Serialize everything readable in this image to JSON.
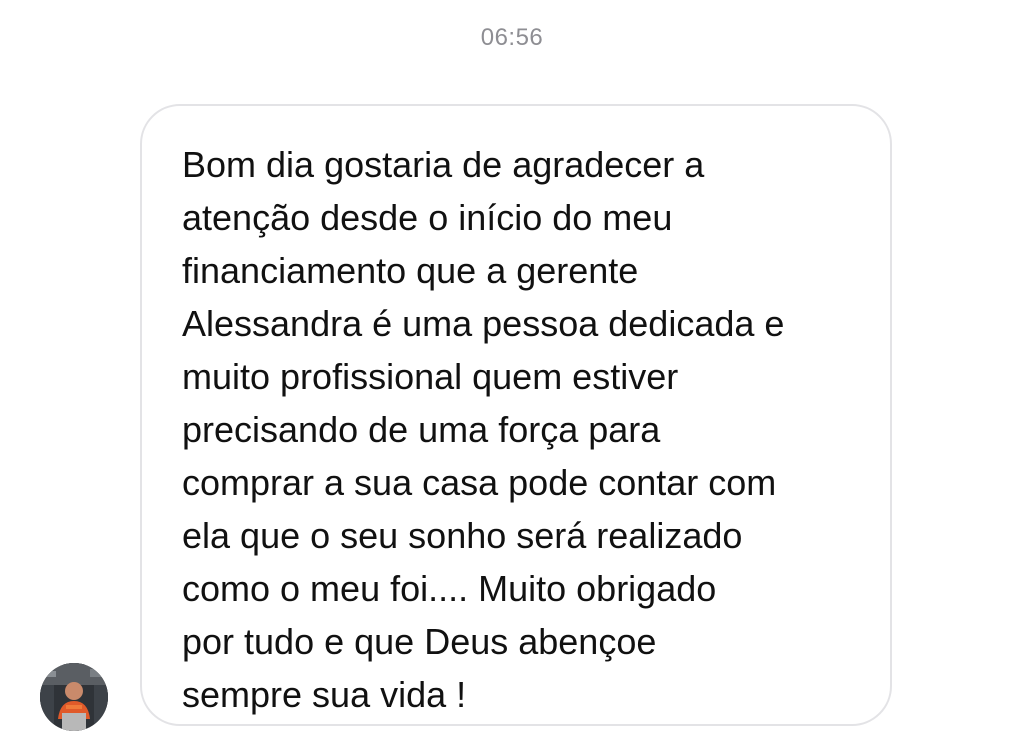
{
  "conversation": {
    "timestamp": "06:56",
    "message": {
      "text": "Bom dia gostaria de agradecer a\natenção desde o início do meu\nfinanciamento que a gerente\nAlessandra é uma pessoa dedicada e\nmuito profissional quem estiver\nprecisando de uma força para\ncomprar a sua casa pode contar com\nela que o seu sonho será realizado\ncomo o meu foi.... Muito obrigado\npor tudo e que Deus abençoe\nsempre sua vida !"
    },
    "sender": {
      "avatar_icon": "user-avatar-photo"
    }
  },
  "colors": {
    "timestamp": "#8e8e93",
    "bubble_border": "#e3e3e6",
    "text": "#111111",
    "background": "#ffffff"
  }
}
